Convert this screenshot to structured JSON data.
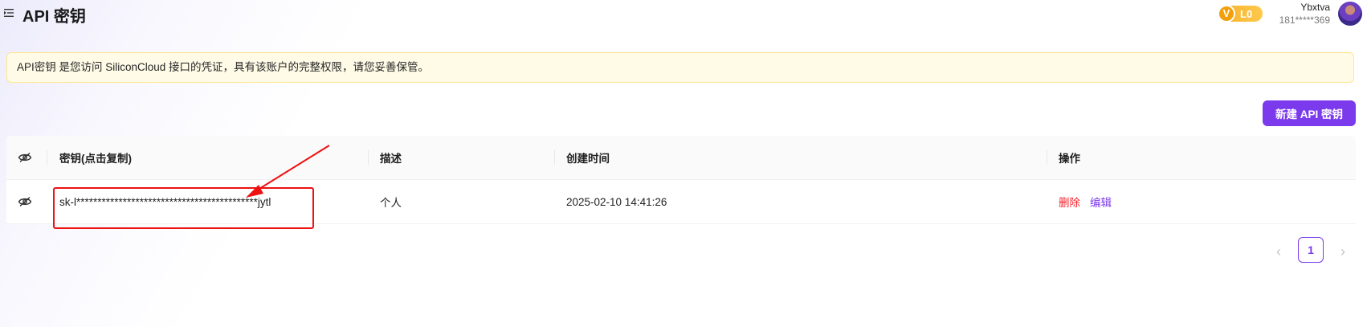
{
  "header": {
    "title": "API 密钥",
    "level_badge": {
      "icon_letter": "V",
      "level": "L0"
    },
    "user": {
      "name": "Ybxtva",
      "phone": "181*****369"
    }
  },
  "notice": {
    "text": "API密钥 是您访问 SiliconCloud 接口的凭证，具有该账户的完整权限，请您妥善保管。"
  },
  "toolbar": {
    "create_label": "新建 API 密钥"
  },
  "table": {
    "columns": [
      "",
      "密钥(点击复制)",
      "描述",
      "创建时间",
      "操作"
    ],
    "rows": [
      {
        "key": "sk-l*******************************************jytl",
        "description": "个人",
        "created": "2025-02-10 14:41:26",
        "actions": {
          "delete": "删除",
          "edit": "编辑"
        }
      }
    ]
  },
  "pagination": {
    "prev": "‹",
    "current": "1",
    "next": "›"
  },
  "icons": {
    "menu": "menu-collapse-icon",
    "eye": "eye-off-icon",
    "badge": "vip-badge-icon",
    "avatar": "user-avatar"
  },
  "colors": {
    "accent": "#7c3aed",
    "danger": "#f5222d",
    "notice_bg": "#fffbe6",
    "badge": "#f5b12a",
    "annotation": "#ee1111"
  }
}
